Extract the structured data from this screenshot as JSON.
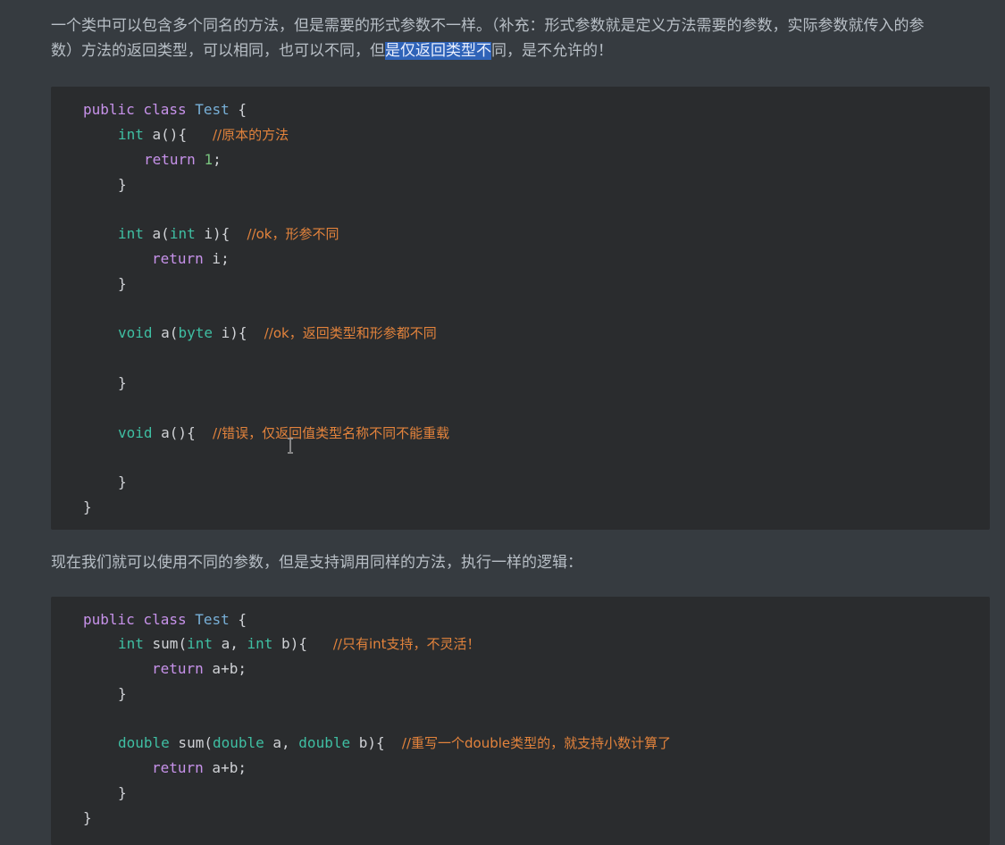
{
  "intro": {
    "line1": "一个类中可以包含多个同名的方法，但是需要的形式参数不一样。（补充：形式参数就是定义方法需要的参数，实际参数就传入的参",
    "line2_before": "数）方法的返回类型，可以相同，也可以不同，但",
    "line2_highlight": "是仅返回类型不",
    "line2_after": "同，是不允许的！"
  },
  "code1": {
    "l1_kw": "public class ",
    "l1_ty": "Test",
    "l1_rest": " {",
    "l2_ty": "int",
    "l2_code": " a(){   ",
    "l2_cmt": "//原本的方法",
    "l3_kw": "return ",
    "l3_num": "1",
    "l3_rest": ";",
    "l4": "}",
    "l5_ty": "int",
    "l5_a": " a(",
    "l5_ty2": "int",
    "l5_b": " i){  ",
    "l5_cmt": "//ok，形参不同",
    "l6_kw": "return",
    "l6_rest": " i;",
    "l7": "}",
    "l8_ty": "void",
    "l8_a": " a(",
    "l8_ty2": "byte",
    "l8_b": " i){  ",
    "l8_cmt": "//ok，返回类型和形参都不同",
    "l9": "}",
    "l10_ty": "void",
    "l10_a": " a(){  ",
    "l10_cmt": "//错误，仅返回值类型名称不同不能重载",
    "l11": "}",
    "l12": "}"
  },
  "middle": {
    "text": "现在我们就可以使用不同的参数，但是支持调用同样的方法，执行一样的逻辑："
  },
  "code2": {
    "l1_kw": "public class ",
    "l1_ty": "Test",
    "l1_rest": " {",
    "l2_ty": "int",
    "l2_a": " sum(",
    "l2_ty2": "int",
    "l2_b": " a, ",
    "l2_ty3": "int",
    "l2_c": " b){   ",
    "l2_cmt": "//只有int支持，不灵活！",
    "l3_kw": "return",
    "l3_rest": " a+b;",
    "l4": "}",
    "l5_ty": "double",
    "l5_a": " sum(",
    "l5_ty2": "double",
    "l5_b": " a, ",
    "l5_ty3": "double",
    "l5_c": " b){  ",
    "l5_cmt": "//重写一个double类型的，就支持小数计算了",
    "l6_kw": "return",
    "l6_rest": " a+b;",
    "l7": "}",
    "l8": "}"
  }
}
